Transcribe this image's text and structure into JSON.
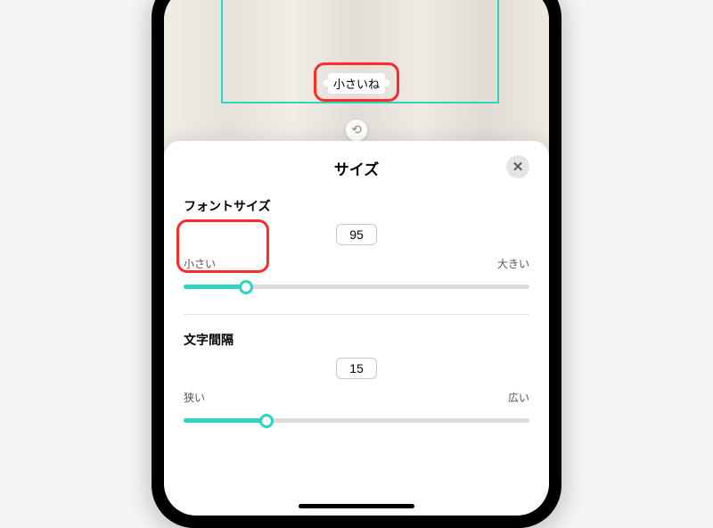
{
  "canvas": {
    "text_preview": "小さいね"
  },
  "sheet": {
    "title": "サイズ"
  },
  "font_size": {
    "label": "フォントサイズ",
    "value": "95",
    "min_label": "小さい",
    "max_label": "大きい"
  },
  "letter_spacing": {
    "label": "文字間隔",
    "value": "15",
    "min_label": "狭い",
    "max_label": "広い"
  }
}
